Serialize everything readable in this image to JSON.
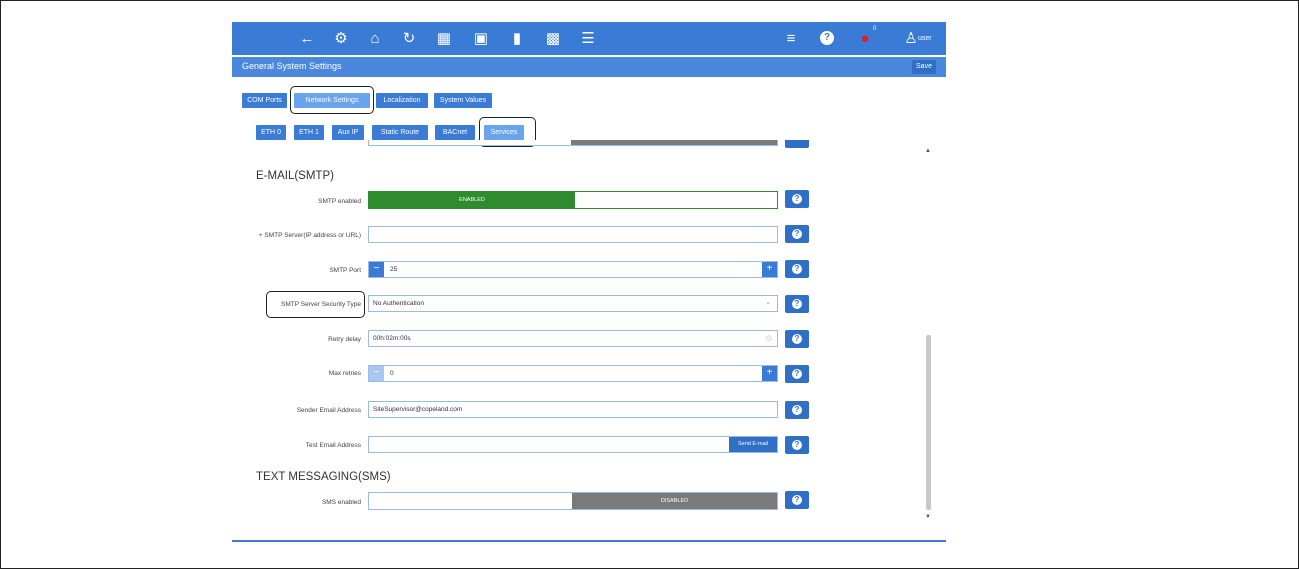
{
  "topbar": {
    "icons": [
      "back-arrow-icon",
      "gear-icon",
      "home-icon",
      "refresh-icon",
      "box-icon",
      "calendar-icon",
      "map-icon",
      "grid-icon",
      "list-icon",
      "add-list-icon",
      "help-icon",
      "alarm-bell-icon",
      "user-icon"
    ],
    "alarm_count": "0",
    "user_label": "user"
  },
  "title": {
    "text": "General System Settings",
    "save_label": "Save"
  },
  "tabs": [
    {
      "label": "COM Ports"
    },
    {
      "label": "Network Settings"
    },
    {
      "label": "Localization"
    },
    {
      "label": "System Values"
    }
  ],
  "subtabs": [
    {
      "label": "ETH 0"
    },
    {
      "label": "ETH 1"
    },
    {
      "label": "Aux IP"
    },
    {
      "label": "Static Route"
    },
    {
      "label": "BACnet"
    },
    {
      "label": "Services"
    }
  ],
  "email_section": {
    "heading": "E-MAIL(SMTP)",
    "smtp_enabled": {
      "label": "SMTP enabled",
      "value": "ENABLED"
    },
    "smtp_server": {
      "label": "+ SMTP Server(IP address or URL)",
      "value": ""
    },
    "smtp_port": {
      "label": "SMTP Port",
      "value": "25",
      "minus": "−",
      "plus": "+"
    },
    "security_type": {
      "label": "SMTP Server Security Type",
      "value": "No Authentication"
    },
    "retry_delay": {
      "label": "Retry delay",
      "value": "00h:02m:00s"
    },
    "max_retries": {
      "label": "Max retries",
      "value": "0",
      "minus": "−",
      "plus": "+"
    },
    "sender_email": {
      "label": "Sender Email Address",
      "value": "SiteSupervisor@copeland.com"
    },
    "test_email": {
      "label": "Test Email Address",
      "value": "",
      "button": "Send E-mail"
    }
  },
  "sms_section": {
    "heading": "TEXT MESSAGING(SMS)",
    "sms_enabled": {
      "label": "SMS enabled",
      "value": "DISABLED"
    }
  },
  "colors": {
    "primary": "#3a7bd5",
    "enabled": "#2e8b2e",
    "disabled": "#7a7a7a"
  }
}
